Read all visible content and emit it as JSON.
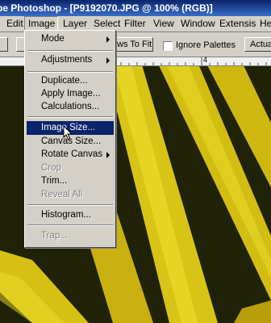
{
  "window": {
    "title": "be Photoshop - [P9192070.JPG @ 100% (RGB)]"
  },
  "menubar": {
    "items": [
      "Edit",
      "Image",
      "Layer",
      "Select",
      "Filter",
      "View",
      "Window",
      "Extensis",
      "He"
    ]
  },
  "options_bar": {
    "fit_label": "ws To Fit",
    "ignore_palettes_label": "Ignore Palettes",
    "actual_label": "Actual"
  },
  "ruler": {
    "label": "4"
  },
  "image_menu": {
    "items": [
      {
        "label": "Mode",
        "submenu": true,
        "enabled": true
      },
      {
        "label": "Adjustments",
        "submenu": true,
        "enabled": true
      },
      {
        "label": "Duplicate...",
        "enabled": true
      },
      {
        "label": "Apply Image...",
        "enabled": true
      },
      {
        "label": "Calculations...",
        "enabled": true
      },
      {
        "label": "Image Size...",
        "enabled": true,
        "highlighted": true
      },
      {
        "label": "Canvas Size...",
        "enabled": true
      },
      {
        "label": "Rotate Canvas",
        "submenu": true,
        "enabled": true
      },
      {
        "label": "Crop",
        "enabled": false
      },
      {
        "label": "Trim...",
        "enabled": true
      },
      {
        "label": "Reveal All",
        "enabled": false
      },
      {
        "label": "Histogram...",
        "enabled": true
      },
      {
        "label": "Trap...",
        "enabled": false
      }
    ]
  },
  "colors": {
    "menu_bg": "#d4d0c8",
    "highlight": "#0a246a",
    "petal": "#e8d21c"
  }
}
